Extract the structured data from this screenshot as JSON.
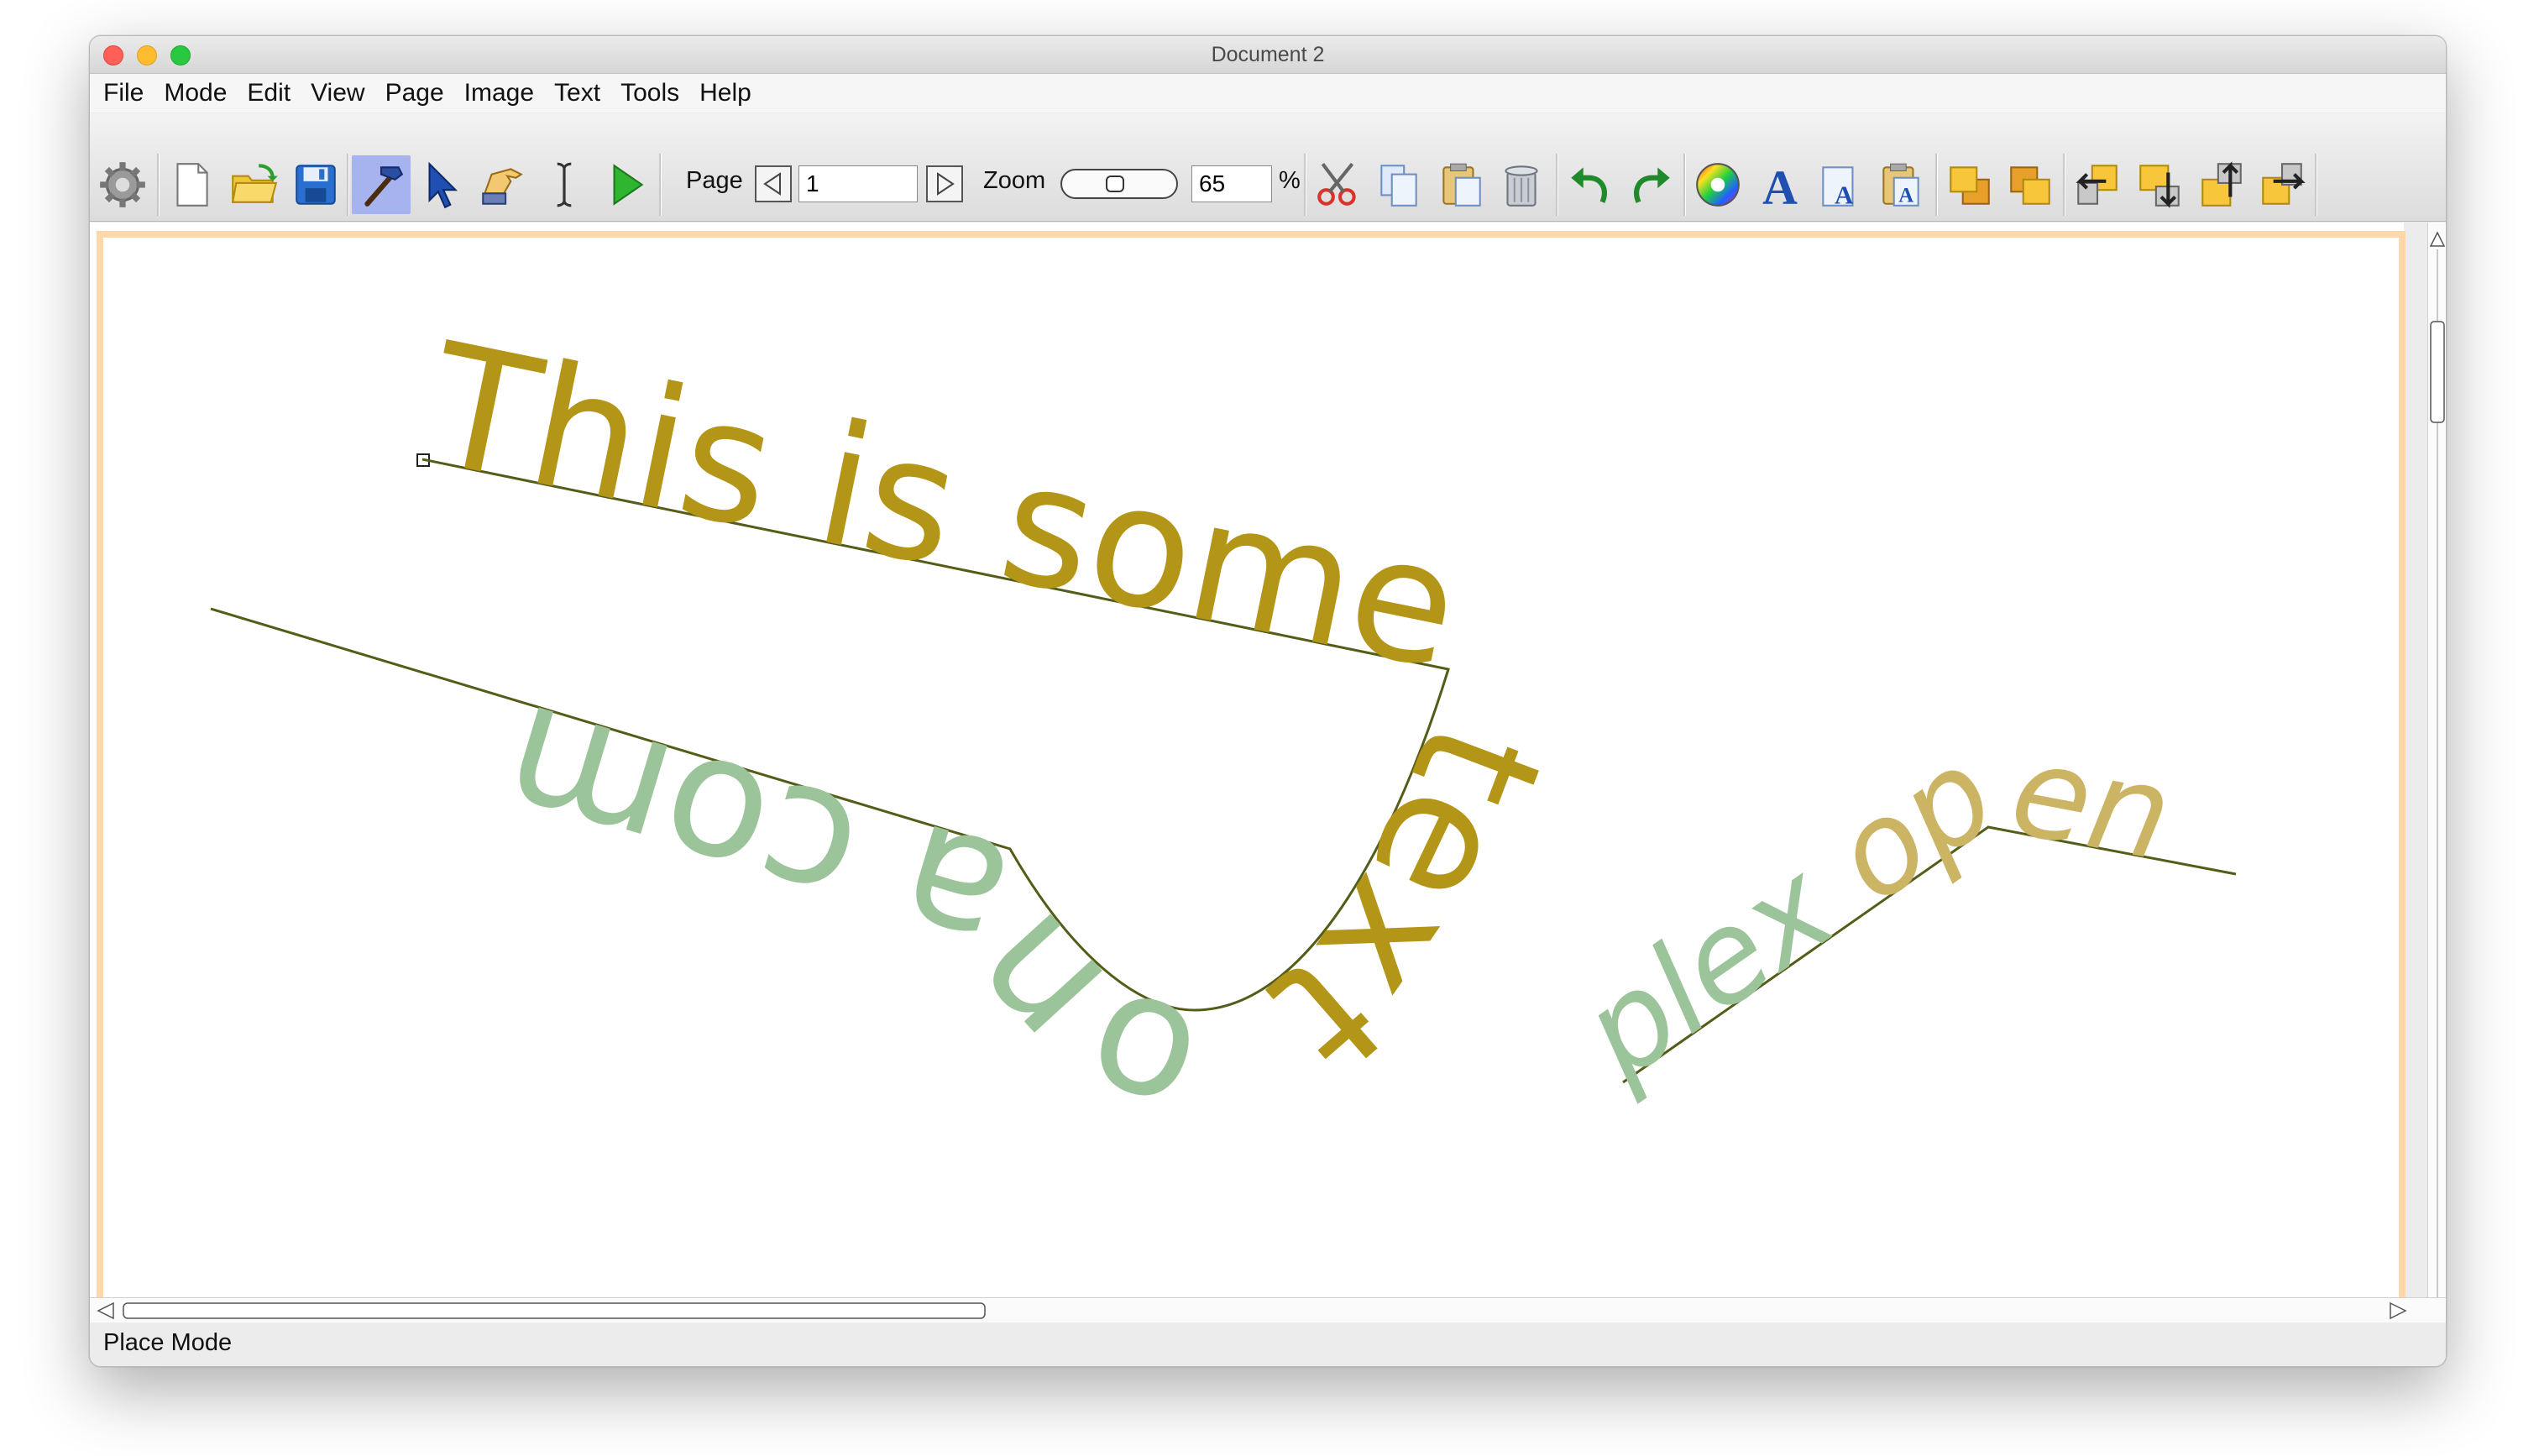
{
  "window": {
    "title": "Document 2"
  },
  "menu": [
    "File",
    "Mode",
    "Edit",
    "View",
    "Page",
    "Image",
    "Text",
    "Tools",
    "Help"
  ],
  "toolbar": {
    "page_label": "Page",
    "page_value": "1",
    "zoom_label": "Zoom",
    "zoom_value": "65",
    "zoom_unit": "%",
    "active_tool": "place-tool"
  },
  "canvas": {
    "path_text_1": "This is some text on a complex open path...",
    "colors": {
      "gold": "#b39518",
      "green": "#9cc49a",
      "light_gold": "#cbb565",
      "path_line": "#555c18",
      "page_border": "#ffd7a8"
    }
  },
  "status": {
    "mode": "Place Mode"
  }
}
